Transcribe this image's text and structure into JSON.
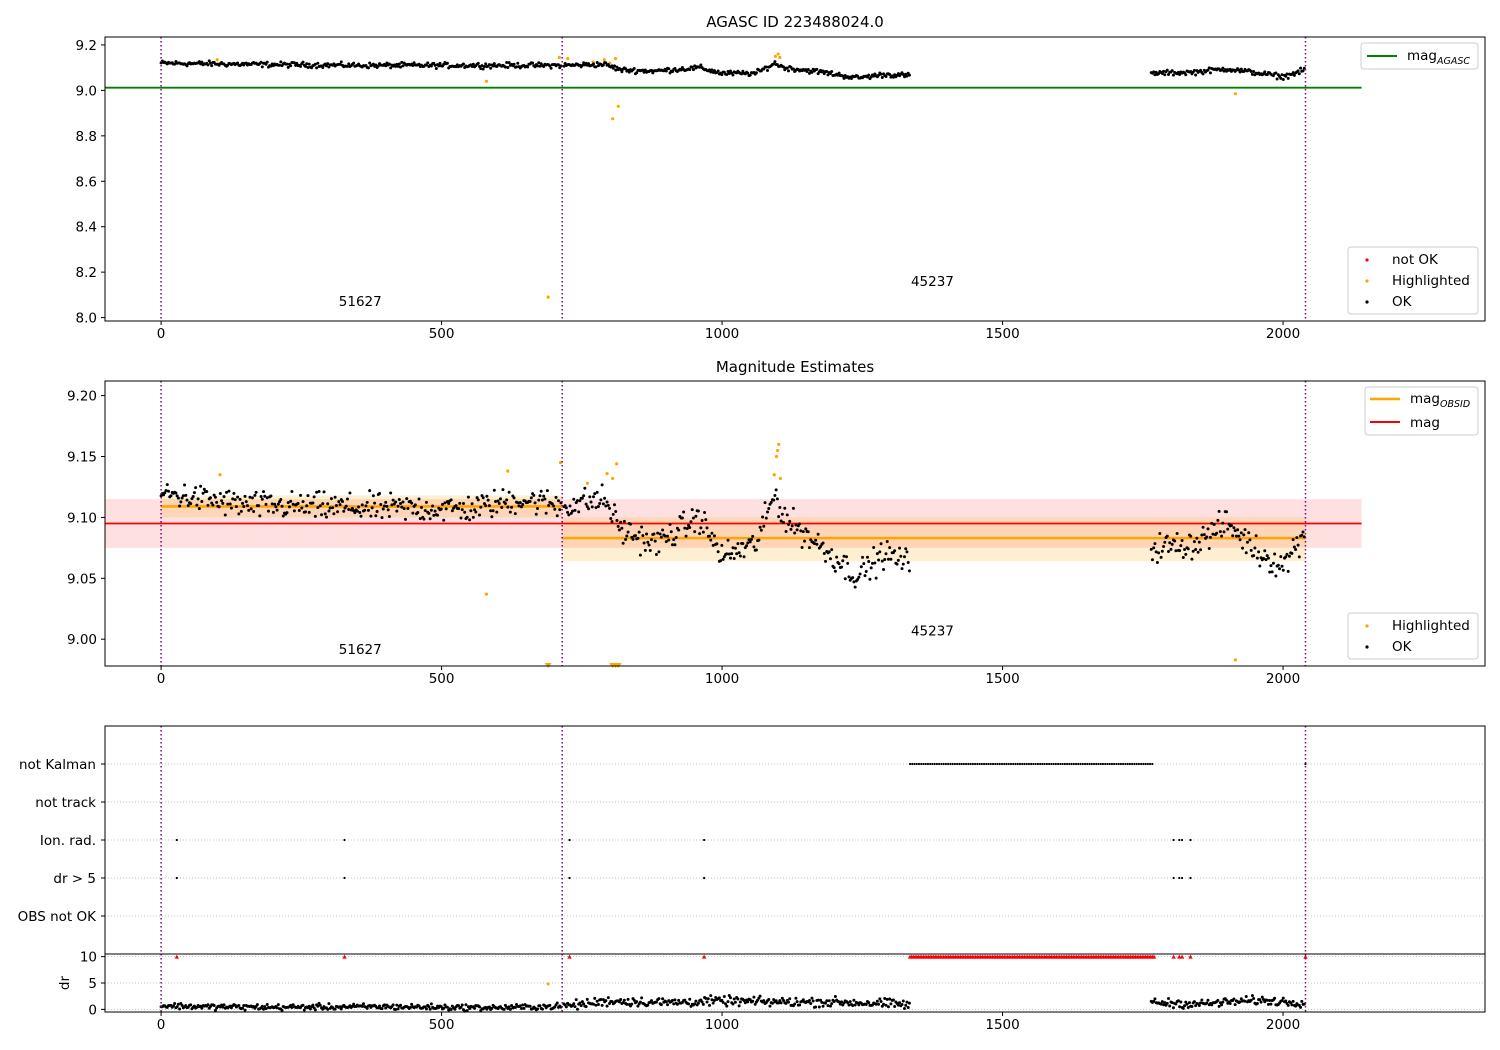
{
  "chart_data": [
    {
      "type": "scatter",
      "title": "AGASC ID 223488024.0",
      "xlim": [
        -100,
        2360
      ],
      "ylim": [
        7.985,
        9.235
      ],
      "xticks": [
        0,
        500,
        1000,
        1500,
        2000
      ],
      "yticks": [
        8.0,
        8.2,
        8.4,
        8.6,
        8.8,
        9.0,
        9.2
      ],
      "ytick_labels": [
        "8.0",
        "8.2",
        "8.4",
        "8.6",
        "8.8",
        "9.0",
        "9.2"
      ],
      "obs_boundaries": [
        0,
        715,
        2040
      ],
      "obs_labels": [
        {
          "text": "51627",
          "x": 355,
          "y": 8.05
        },
        {
          "text": "45237",
          "x": 1375,
          "y": 8.14
        }
      ],
      "mag_agasc": {
        "name": "mag_AGASC",
        "value": 9.012,
        "x_range": [
          -100,
          2140
        ],
        "color": "#008000"
      },
      "series": [
        {
          "name": "not OK",
          "color": "#ff0000",
          "points": []
        },
        {
          "name": "Highlighted",
          "color": "#ffa500",
          "points": [
            [
              100,
              9.135
            ],
            [
              580,
              9.04
            ],
            [
              690,
              8.09
            ],
            [
              710,
              9.145
            ],
            [
              725,
              9.14
            ],
            [
              770,
              9.125
            ],
            [
              790,
              9.135
            ],
            [
              800,
              9.12
            ],
            [
              805,
              8.875
            ],
            [
              810,
              9.14
            ],
            [
              815,
              8.93
            ],
            [
              1095,
              9.15
            ],
            [
              1100,
              9.16
            ],
            [
              1103,
              9.145
            ],
            [
              1915,
              8.985
            ]
          ]
        },
        {
          "name": "OK",
          "color": "#000000",
          "segments": [
            {
              "x_start": 0,
              "x_end": 715,
              "knots": [
                [
                  0,
                  9.12
                ],
                [
                  150,
                  9.115
                ],
                [
                  350,
                  9.11
                ],
                [
                  550,
                  9.11
                ],
                [
                  715,
                  9.11
                ]
              ],
              "noise": 0.007,
              "step": 2.2
            },
            {
              "x_start": 718,
              "x_end": 1335,
              "knots": [
                [
                  718,
                  9.11
                ],
                [
                  790,
                  9.115
                ],
                [
                  820,
                  9.09
                ],
                [
                  880,
                  9.085
                ],
                [
                  960,
                  9.1
                ],
                [
                  1000,
                  9.075
                ],
                [
                  1060,
                  9.075
                ],
                [
                  1095,
                  9.12
                ],
                [
                  1110,
                  9.1
                ],
                [
                  1180,
                  9.08
                ],
                [
                  1240,
                  9.055
                ],
                [
                  1290,
                  9.07
                ],
                [
                  1335,
                  9.065
                ]
              ],
              "noise": 0.007,
              "step": 2.2
            },
            {
              "x_start": 1765,
              "x_end": 2040,
              "knots": [
                [
                  1765,
                  9.075
                ],
                [
                  1840,
                  9.08
                ],
                [
                  1900,
                  9.095
                ],
                [
                  1960,
                  9.075
                ],
                [
                  2000,
                  9.06
                ],
                [
                  2040,
                  9.09
                ]
              ],
              "noise": 0.007,
              "step": 2.2
            }
          ]
        }
      ],
      "legends": {
        "upper": [
          {
            "label": "mag",
            "sub": "AGASC",
            "color": "#008000"
          }
        ],
        "lower": [
          {
            "label": "not OK",
            "color": "#ff0000"
          },
          {
            "label": "Highlighted",
            "color": "#ffa500"
          },
          {
            "label": "OK",
            "color": "#000000"
          }
        ]
      }
    },
    {
      "type": "scatter",
      "title": "Magnitude Estimates",
      "xlim": [
        -100,
        2360
      ],
      "ylim": [
        8.978,
        9.212
      ],
      "xticks": [
        0,
        500,
        1000,
        1500,
        2000
      ],
      "yticks": [
        9.0,
        9.05,
        9.1,
        9.15,
        9.2
      ],
      "ytick_labels": [
        "9.00",
        "9.05",
        "9.10",
        "9.15",
        "9.20"
      ],
      "obs_boundaries": [
        0,
        715,
        2040
      ],
      "obs_labels": [
        {
          "text": "51627",
          "x": 355,
          "y": 8.988
        },
        {
          "text": "45237",
          "x": 1375,
          "y": 9.003
        }
      ],
      "mag": {
        "name": "mag",
        "value": 9.095,
        "band": [
          9.075,
          9.115
        ],
        "x_range": [
          -100,
          2140
        ],
        "color": "#ff0000"
      },
      "mag_obsid": [
        {
          "name": "mag_OBSID",
          "x_range": [
            0,
            715
          ],
          "value": 9.109,
          "band": [
            9.1,
            9.118
          ]
        },
        {
          "name": "mag_OBSID",
          "x_range": [
            715,
            2040
          ],
          "value": 9.083,
          "band": [
            9.064,
            9.1
          ]
        }
      ],
      "series": [
        {
          "name": "Highlighted",
          "color": "#ffa500",
          "points": [
            [
              105,
              9.135
            ],
            [
              580,
              9.037
            ],
            [
              618,
              9.138
            ],
            [
              712,
              9.145
            ],
            [
              760,
              9.128
            ],
            [
              795,
              9.136
            ],
            [
              805,
              9.132
            ],
            [
              812,
              9.144
            ],
            [
              1093,
              9.135
            ],
            [
              1097,
              9.15
            ],
            [
              1099,
              9.155
            ],
            [
              1101,
              9.16
            ],
            [
              1104,
              9.132
            ],
            [
              1915,
              8.983
            ]
          ]
        },
        {
          "name": "Highlighted (out of range)",
          "color": "#ffa500",
          "marker": "triangle-down",
          "points": [
            [
              690,
              8.978
            ],
            [
              805,
              8.978
            ],
            [
              810,
              8.978
            ],
            [
              815,
              8.978
            ]
          ]
        },
        {
          "name": "OK",
          "color": "#000000",
          "segments": [
            {
              "x_start": 0,
              "x_end": 715,
              "knots": [
                [
                  0,
                  9.12
                ],
                [
                  150,
                  9.11
                ],
                [
                  350,
                  9.108
                ],
                [
                  550,
                  9.107
                ],
                [
                  640,
                  9.115
                ],
                [
                  715,
                  9.11
                ]
              ],
              "noise": 0.007,
              "step": 2.2
            },
            {
              "x_start": 718,
              "x_end": 1335,
              "knots": [
                [
                  718,
                  9.11
                ],
                [
                  790,
                  9.115
                ],
                [
                  820,
                  9.09
                ],
                [
                  880,
                  9.078
                ],
                [
                  960,
                  9.1
                ],
                [
                  1000,
                  9.068
                ],
                [
                  1060,
                  9.078
                ],
                [
                  1095,
                  9.12
                ],
                [
                  1110,
                  9.1
                ],
                [
                  1180,
                  9.075
                ],
                [
                  1240,
                  9.052
                ],
                [
                  1290,
                  9.07
                ],
                [
                  1335,
                  9.062
                ]
              ],
              "noise": 0.007,
              "step": 2.2
            },
            {
              "x_start": 1765,
              "x_end": 2040,
              "knots": [
                [
                  1765,
                  9.075
                ],
                [
                  1840,
                  9.078
                ],
                [
                  1900,
                  9.095
                ],
                [
                  1960,
                  9.07
                ],
                [
                  2000,
                  9.06
                ],
                [
                  2040,
                  9.09
                ]
              ],
              "noise": 0.007,
              "step": 2.2
            }
          ]
        }
      ],
      "legends": {
        "upper": [
          {
            "label": "mag",
            "sub": "OBSID",
            "color": "#ffa500"
          },
          {
            "label": "mag",
            "sub": "",
            "color": "#ff0000"
          }
        ],
        "lower": [
          {
            "label": "Highlighted",
            "color": "#ffa500"
          },
          {
            "label": "OK",
            "color": "#000000"
          }
        ]
      }
    },
    {
      "type": "scatter",
      "title": "",
      "xlim": [
        -100,
        2360
      ],
      "categories": [
        "not Kalman",
        "not track",
        "Ion. rad.",
        "dr > 5",
        "OBS not OK"
      ],
      "obs_boundaries": [
        0,
        715,
        2040
      ],
      "flags": [
        {
          "category": "not Kalman",
          "ranges": [
            [
              1335,
              1770,
              4
            ]
          ],
          "points": [
            2040
          ]
        },
        {
          "category": "not track",
          "ranges": [],
          "points": []
        },
        {
          "category": "Ion. rad.",
          "ranges": [],
          "points": [
            28,
            327,
            728,
            968,
            1805,
            1815,
            1820,
            1835
          ]
        },
        {
          "category": "dr > 5",
          "ranges": [],
          "points": [
            28,
            327,
            728,
            968,
            1805,
            1815,
            1820,
            1835
          ]
        },
        {
          "category": "OBS not OK",
          "ranges": [],
          "points": []
        }
      ]
    },
    {
      "type": "scatter",
      "title": "",
      "ylabel": "dr",
      "xlim": [
        -100,
        2360
      ],
      "ylim": [
        -0.5,
        10.5
      ],
      "xticks": [
        0,
        500,
        1000,
        1500,
        2000
      ],
      "yticks": [
        0,
        5,
        10
      ],
      "ytick_labels": [
        "0",
        "5",
        "10"
      ],
      "obs_boundaries": [
        0,
        715,
        2040
      ],
      "series": [
        {
          "name": "dr > 5",
          "color": "#ff0000",
          "marker": "triangle-up",
          "ranges": [
            [
              1335,
              1770,
              3
            ]
          ],
          "points": [
            28,
            327,
            728,
            968,
            1805,
            1815,
            1820,
            1835,
            2040
          ],
          "value": 10
        },
        {
          "name": "Highlighted",
          "color": "#ffa500",
          "points": [
            [
              690,
              4.8
            ]
          ]
        },
        {
          "name": "OK",
          "color": "#000000",
          "segments": [
            {
              "x_start": 0,
              "x_end": 715,
              "knots": [
                [
                  0,
                  0.7
                ],
                [
                  80,
                  0.5
                ],
                [
                  200,
                  0.4
                ],
                [
                  400,
                  0.5
                ],
                [
                  600,
                  0.3
                ],
                [
                  715,
                  0.6
                ]
              ],
              "noise": 0.35,
              "step": 2.2
            },
            {
              "x_start": 718,
              "x_end": 1335,
              "knots": [
                [
                  718,
                  0.6
                ],
                [
                  800,
                  1.6
                ],
                [
                  900,
                  1.3
                ],
                [
                  1000,
                  1.6
                ],
                [
                  1100,
                  1.4
                ],
                [
                  1200,
                  1.4
                ],
                [
                  1335,
                  0.9
                ]
              ],
              "noise": 0.55,
              "step": 2.2
            },
            {
              "x_start": 1765,
              "x_end": 2040,
              "knots": [
                [
                  1765,
                  1.3
                ],
                [
                  1850,
                  1.0
                ],
                [
                  1950,
                  1.7
                ],
                [
                  2040,
                  1.3
                ]
              ],
              "noise": 0.5,
              "step": 2.2
            }
          ]
        }
      ]
    }
  ]
}
